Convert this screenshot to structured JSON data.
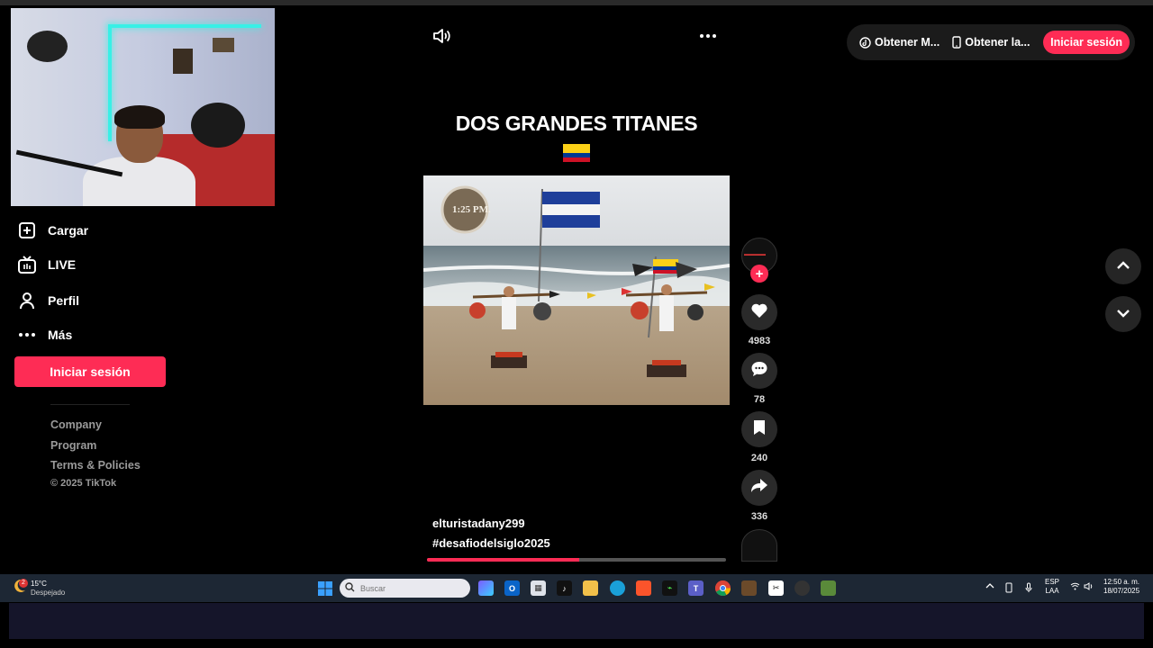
{
  "sidebar": {
    "items": [
      {
        "label": "Cargar",
        "icon": "upload-icon"
      },
      {
        "label": "LIVE",
        "icon": "live-tv-icon"
      },
      {
        "label": "Perfil",
        "icon": "user-icon"
      },
      {
        "label": "Más",
        "icon": "more-dots-icon"
      }
    ],
    "login_button": "Iniciar sesión",
    "footer": {
      "company": "Company",
      "program": "Program",
      "terms": "Terms & Policies",
      "copyright": "© 2025 TikTok"
    }
  },
  "topbar": {
    "get_app_1": "Obtener M...",
    "get_app_2": "Obtener la...",
    "signin": "Iniciar sesión"
  },
  "video": {
    "title": "DOS GRANDES TITANES",
    "clock_overlay": "1:25 PM.",
    "author": "elturistadany299",
    "hashtag": "#desafiodelsiglo2025",
    "progress_fraction": 0.51
  },
  "actions": {
    "likes": "4983",
    "comments": "78",
    "saves": "240",
    "shares": "336"
  },
  "taskbar": {
    "weather_badge": "2",
    "temperature": "15°C",
    "condition": "Despejado",
    "search_placeholder": "Buscar",
    "language_1": "ESP",
    "language_2": "LAA",
    "time": "12:50 a. m.",
    "date": "18/07/2025"
  },
  "colors": {
    "accent": "#fe2c55",
    "background": "#000000",
    "taskbar": "#1d2734"
  }
}
